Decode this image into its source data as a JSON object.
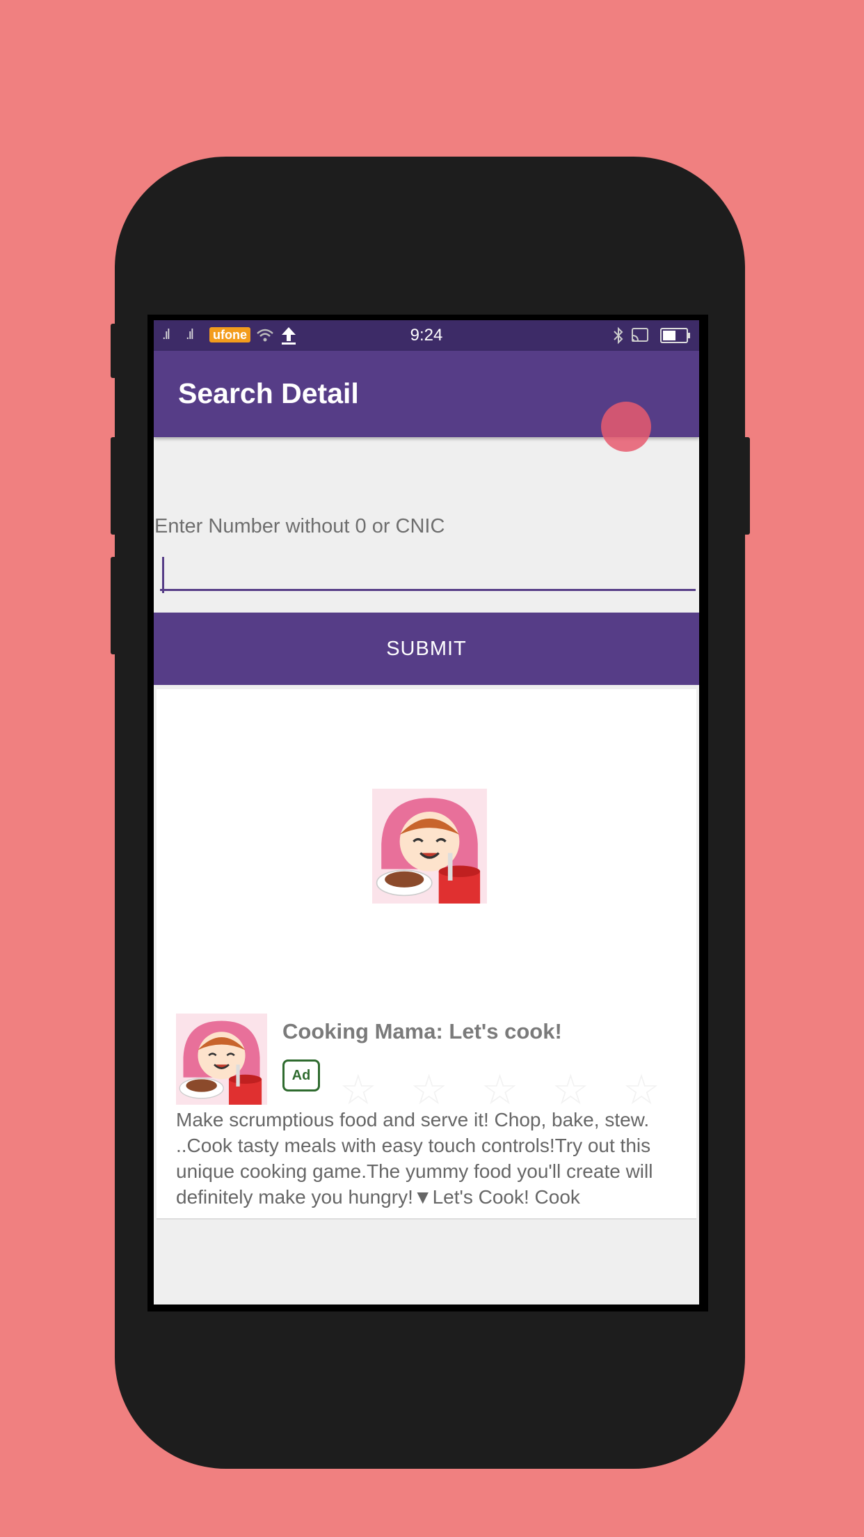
{
  "statusbar": {
    "carrier": "ufone",
    "time": "9:24"
  },
  "appbar": {
    "title": "Search Detail"
  },
  "form": {
    "label": "Enter Number without 0 or CNIC",
    "input_value": "",
    "submit_label": "SUBMIT"
  },
  "ad": {
    "title": "Cooking Mama: Let's cook!",
    "badge": "Ad",
    "description": "Make scrumptious food and serve it! Chop, bake, stew. ..Cook tasty meals with easy touch controls!Try out this unique cooking game.The yummy food you'll create will definitely make you hungry!▼Let's Cook! Cook",
    "rating_stars": 5
  },
  "colors": {
    "background": "#f08080",
    "primary": "#563d87",
    "status_bar": "#3d2b67"
  }
}
